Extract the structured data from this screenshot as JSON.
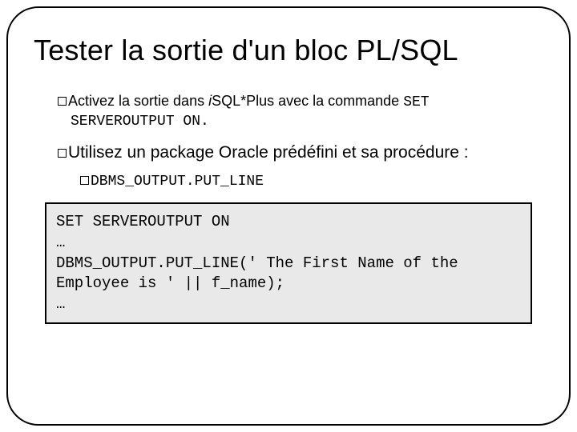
{
  "title": "Tester la sortie d'un bloc PL/SQL",
  "bullets": {
    "b1_pre": "Activez la sortie dans ",
    "b1_iprefix": "i",
    "b1_mid": "SQL*Plus avec la commande ",
    "b1_cmd1": "SET",
    "b1_cmd2": "SERVEROUTPUT ON.",
    "b2": "Utilisez un package Oracle prédéfini et sa procédure :",
    "b3": "DBMS_OUTPUT.PUT_LINE"
  },
  "code": {
    "l1": "SET SERVEROUTPUT ON",
    "l2": "…",
    "l3": "DBMS_OUTPUT.PUT_LINE(' The First Name of the Employee is ' || f_name);",
    "l4": "…"
  }
}
